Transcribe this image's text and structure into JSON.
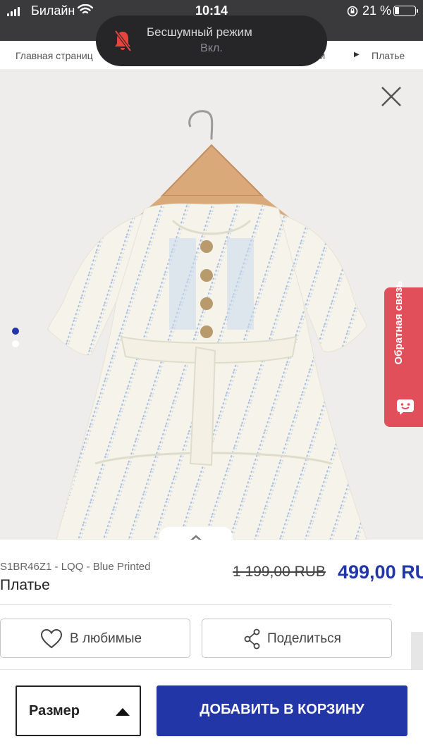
{
  "status_bar": {
    "carrier": "Билайн",
    "time": "10:14",
    "battery": "21 %"
  },
  "toast": {
    "title": "Бесшумный режим",
    "subtitle": "Вкл."
  },
  "breadcrumb": {
    "home": "Главная страниц",
    "previous": "чки",
    "current": "Платье"
  },
  "gallery": {
    "page_count": 2,
    "active_page": 1
  },
  "feedback": {
    "label": "Обратная связь"
  },
  "product": {
    "sku": "S1BR46Z1 - LQQ - Blue Printed",
    "name": "Платье",
    "old_price": "1 199,00 RUB",
    "new_price": "499,00 RU"
  },
  "actions": {
    "favorite_label": "В любимые",
    "share_label": "Поделиться"
  },
  "bottom_bar": {
    "size_label": "Размер",
    "add_to_cart_label": "ДОБАВИТЬ В КОРЗИНУ"
  },
  "colors": {
    "accent": "#2236a8",
    "feedback": "#e14f5b"
  }
}
